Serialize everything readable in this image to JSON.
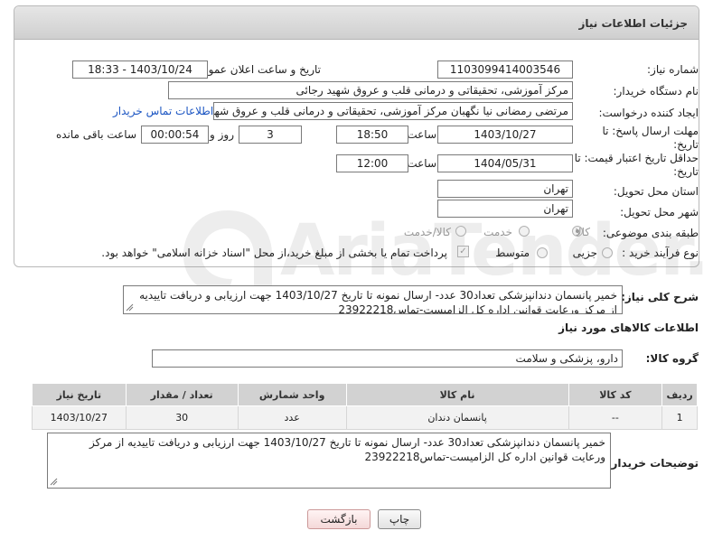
{
  "header": {
    "title": "جزئیات اطلاعات نیاز"
  },
  "fields": {
    "need_number_label": "شماره نیاز:",
    "need_number": "1103099414003546",
    "announce_label": "تاریخ و ساعت اعلان عمومی:",
    "announce_value": "1403/10/24 - 18:33",
    "buyer_org_label": "نام دستگاه خریدار:",
    "buyer_org": "مرکز آموزشی، تحقیقاتی و درمانی قلب و عروق شهید رجائی",
    "requester_label": "ایجاد کننده درخواست:",
    "requester": "مرتضی رمضانی نیا نگهبان مرکز آموزشی، تحقیقاتی و درمانی قلب و عروق شهید رجائی",
    "buyer_contact_link": "اطلاعات تماس خریدار",
    "deadline_label_1": "مهلت ارسال پاسخ: تا",
    "deadline_label_2": "تاریخ:",
    "deadline_date": "1403/10/27",
    "time_label": "ساعت",
    "deadline_time": "18:50",
    "days_value": "3",
    "days_label": "روز و",
    "remaining_time": "00:00:54",
    "remaining_label": "ساعت باقی مانده",
    "validity_label_1": "حداقل تاریخ اعتبار قیمت: تا",
    "validity_label_2": "تاریخ:",
    "validity_date": "1404/05/31",
    "validity_time_label": "ساعت",
    "validity_time": "12:00",
    "province_label": "استان محل تحویل:",
    "province": "تهران",
    "city_label": "شهر محل تحویل:",
    "city": "تهران",
    "category_label": "طبقه بندی موضوعی:",
    "category_options": [
      "کالا",
      "خدمت",
      "کالا/خدمت"
    ],
    "process_label": "نوع فرآیند خرید :",
    "process_options": [
      "جزیی",
      "متوسط"
    ],
    "payment_note": "پرداخت تمام یا بخشی از مبلغ خرید،از محل \"اسناد خزانه اسلامی\" خواهد بود."
  },
  "general": {
    "description_label": "شرح کلی نیاز:",
    "description": "خمیر پانسمان دندانپزشکی تعداد30 عدد- ارسال نمونه تا تاریخ 1403/10/27 جهت ارزیابی و دریافت تاییدیه از مرکز ورعایت قوانین اداره کل الزامیست-تماس23922218",
    "goods_info_title": "اطلاعات کالاهای مورد نیاز",
    "goods_group_label": "گروه کالا:",
    "goods_group": "دارو، پزشکی و سلامت"
  },
  "table": {
    "headers": [
      "ردیف",
      "کد کالا",
      "نام کالا",
      "واحد شمارش",
      "تعداد / مقدار",
      "تاریخ نیاز"
    ],
    "rows": [
      [
        "1",
        "--",
        "پانسمان دندان",
        "عدد",
        "30",
        "1403/10/27"
      ]
    ]
  },
  "buyer_notes": {
    "label": "توضیحات خریدار:",
    "text": "خمیر پانسمان دندانپزشکی تعداد30 عدد- ارسال نمونه تا تاریخ 1403/10/27 جهت ارزیابی و دریافت تاییدیه از مرکز ورعایت قوانین اداره کل الزامیست-تماس23922218"
  },
  "buttons": {
    "print": "چاپ",
    "back": "بازگشت"
  },
  "watermark": {
    "text": "AriaTender.neT"
  },
  "colors": {
    "link": "#1b55c2",
    "header_bg": "#d6d6d6",
    "table_head": "#d2d2d2"
  }
}
